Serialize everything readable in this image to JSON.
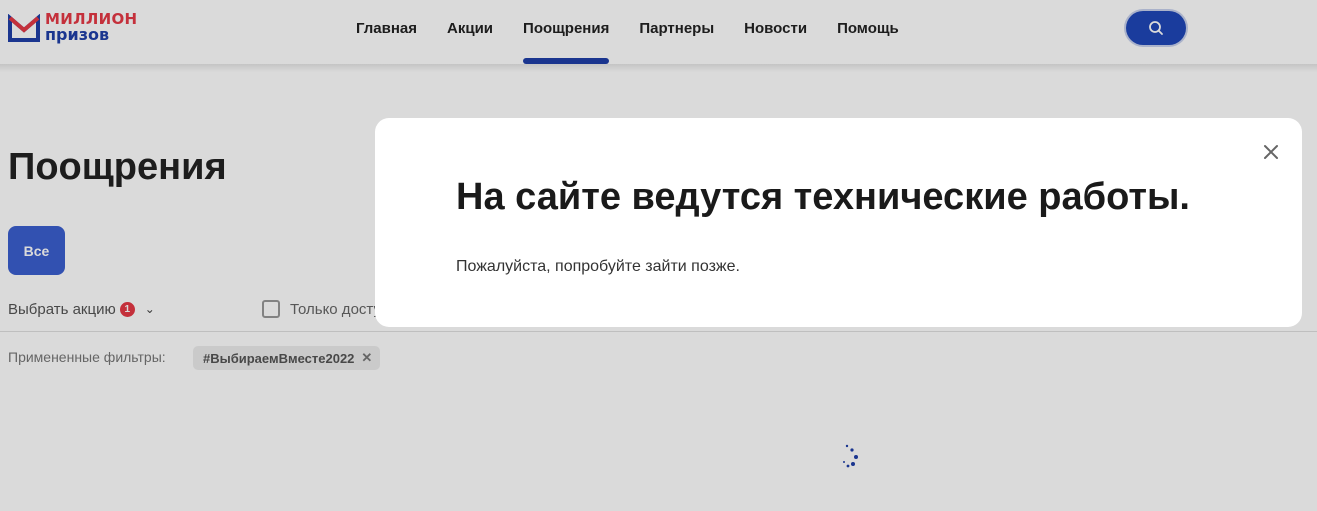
{
  "logo": {
    "line1": "МИЛЛИОН",
    "line2": "призов"
  },
  "nav": {
    "items": [
      {
        "label": "Главная"
      },
      {
        "label": "Акции"
      },
      {
        "label": "Поощрения"
      },
      {
        "label": "Партнеры"
      },
      {
        "label": "Новости"
      },
      {
        "label": "Помощь"
      }
    ],
    "active": "Поощрения"
  },
  "search": {
    "icon": "search-icon"
  },
  "page": {
    "title": "Поощрения",
    "chip_all": "Все",
    "select_label": "Выбрать акцию",
    "select_badge": "1",
    "only_available": "Только досту",
    "applied_filters_label": "Примененные фильтры:",
    "applied_tag": "#ВыбираемВместе2022"
  },
  "modal": {
    "title": "На сайте ведутся технические работы.",
    "text": "Пожалуйста, попробуйте зайти позже."
  },
  "colors": {
    "brand_blue": "#1f3fa8",
    "brand_red": "#e63946",
    "accent_button": "#1f47b8",
    "chip_blue": "#3b5fcf"
  }
}
